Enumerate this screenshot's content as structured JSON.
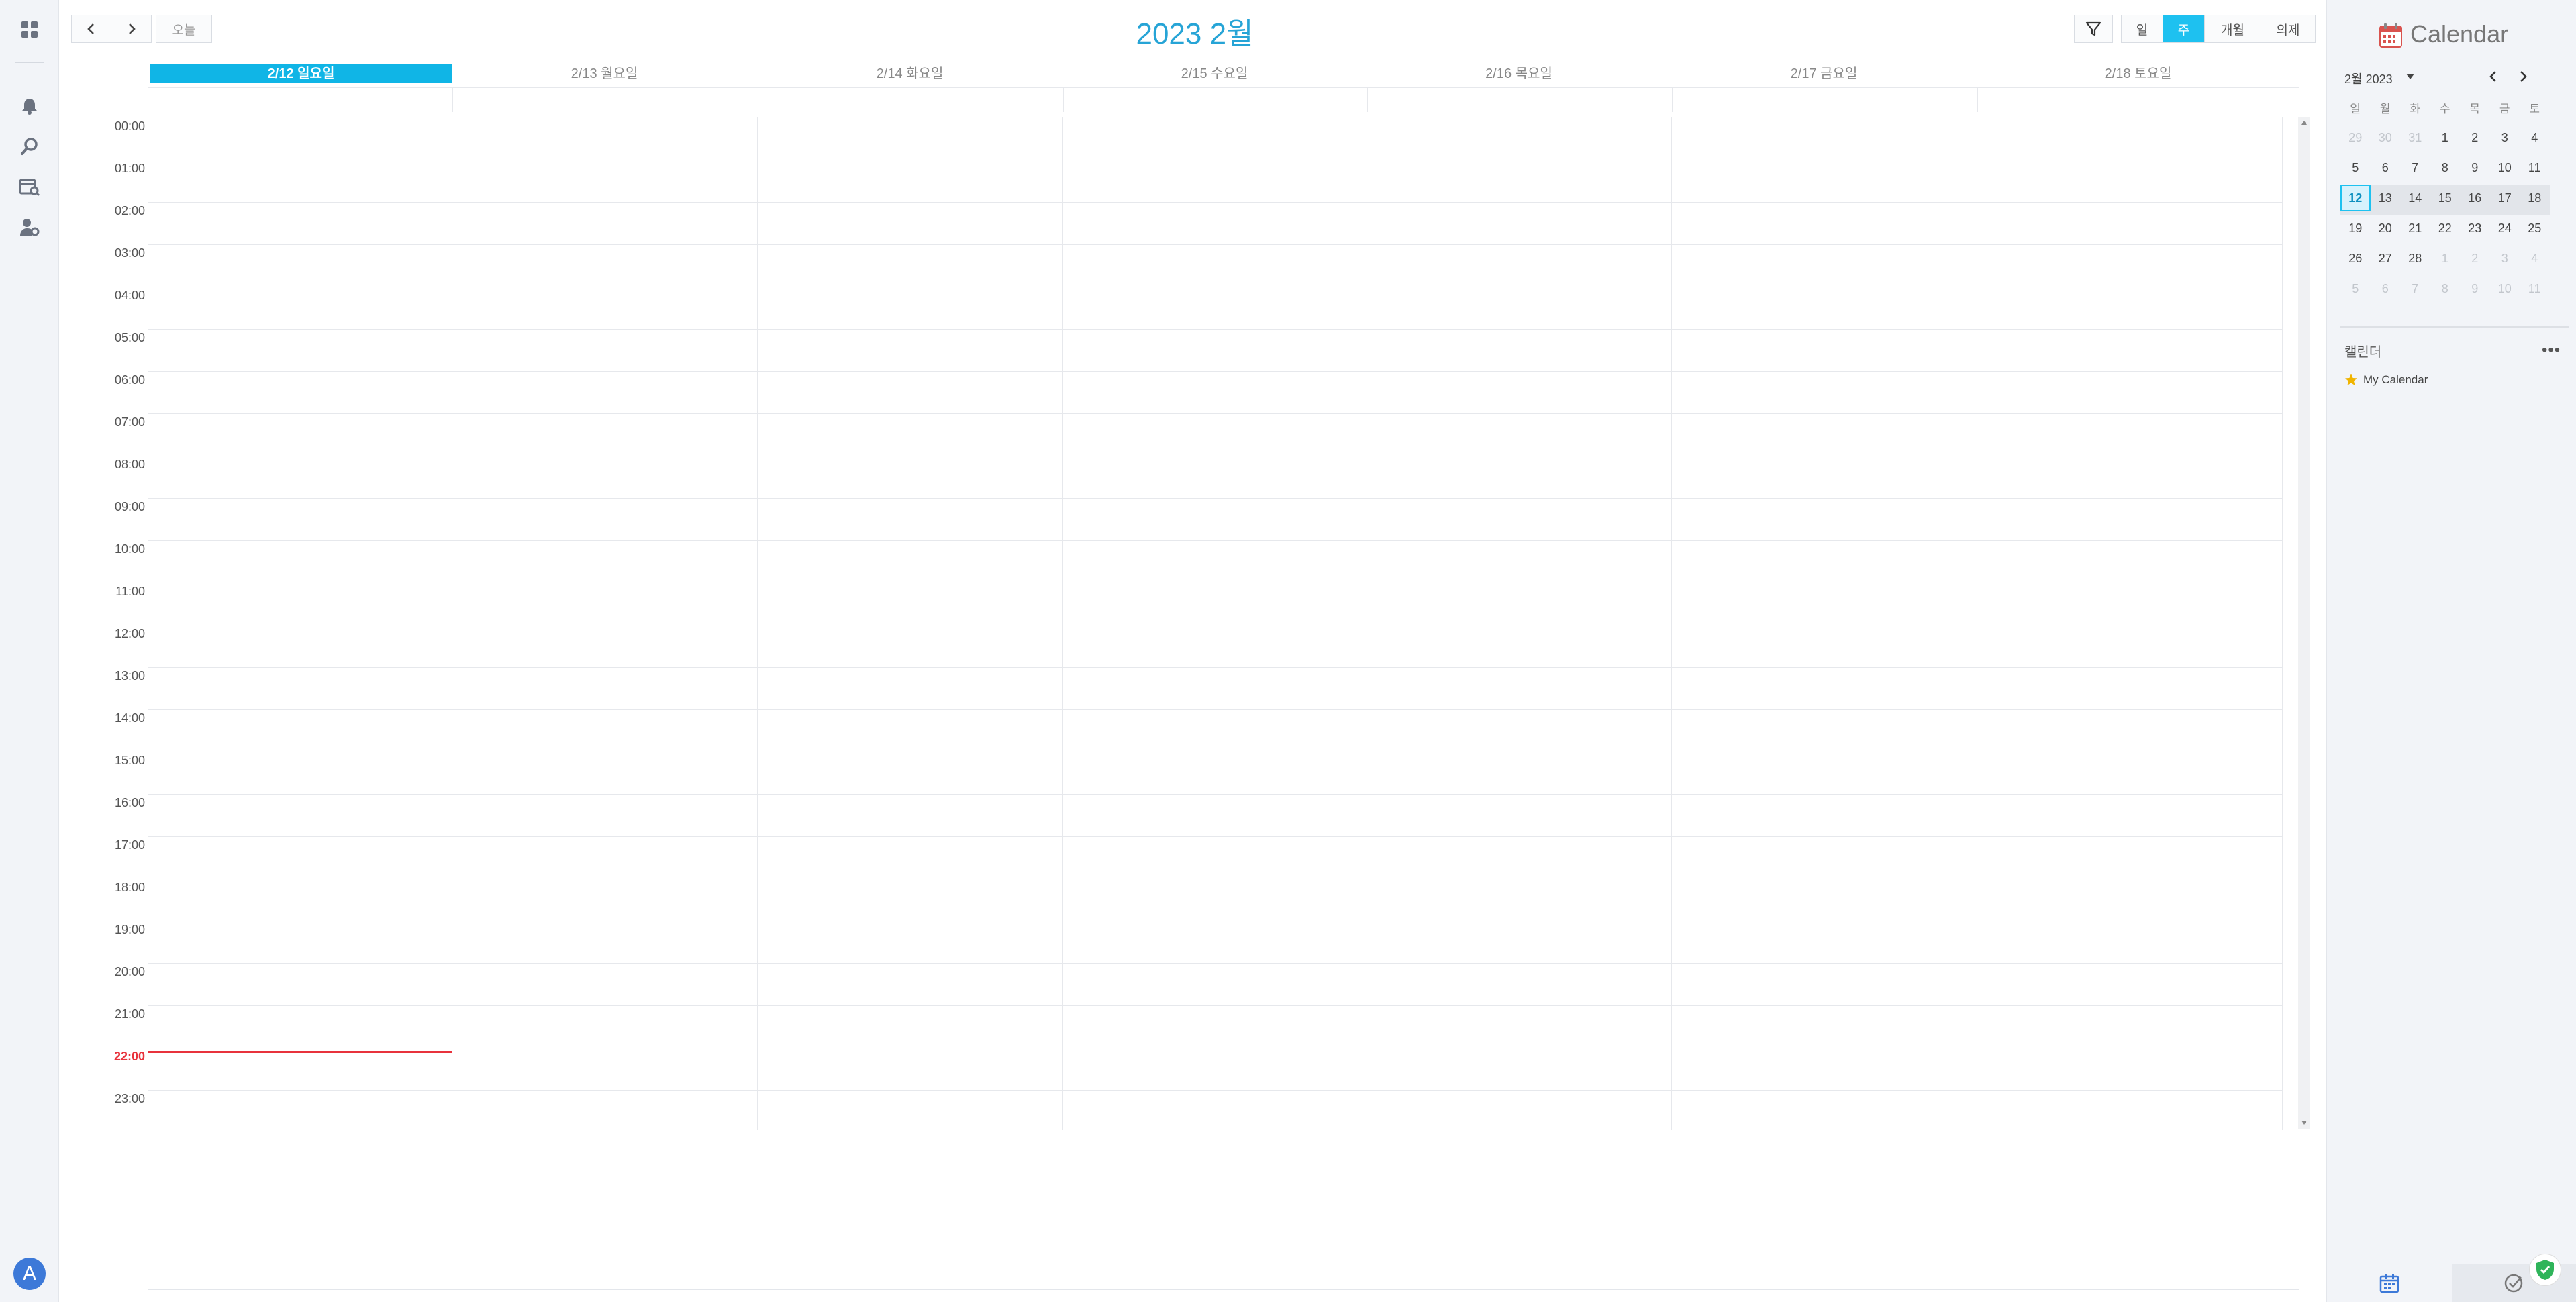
{
  "toolbar": {
    "today_label": "오늘",
    "title": "2023 2월",
    "views": [
      {
        "label": "일",
        "active": false
      },
      {
        "label": "주",
        "active": true
      },
      {
        "label": "개월",
        "active": false
      },
      {
        "label": "의제",
        "active": false
      }
    ],
    "accent_color": "#1ec1f0"
  },
  "week": {
    "days": [
      {
        "label": "2/12 일요일",
        "today": true
      },
      {
        "label": "2/13 월요일",
        "today": false
      },
      {
        "label": "2/14 화요일",
        "today": false
      },
      {
        "label": "2/15 수요일",
        "today": false
      },
      {
        "label": "2/16 목요일",
        "today": false
      },
      {
        "label": "2/17 금요일",
        "today": false
      },
      {
        "label": "2/18 토요일",
        "today": false
      }
    ],
    "hours": [
      "00:00",
      "01:00",
      "02:00",
      "03:00",
      "04:00",
      "05:00",
      "06:00",
      "07:00",
      "08:00",
      "09:00",
      "10:00",
      "11:00",
      "12:00",
      "13:00",
      "14:00",
      "15:00",
      "16:00",
      "17:00",
      "18:00",
      "19:00",
      "20:00",
      "21:00",
      "22:00",
      "23:00"
    ],
    "now_hour": "22:00",
    "now_color": "#e8323c"
  },
  "sidebar_left": {
    "icons": [
      "dashboard-icon",
      "bell-icon",
      "search-icon",
      "calendar-search-icon",
      "user-settings-icon"
    ],
    "avatar_letter": "A"
  },
  "panel": {
    "app_title": "Calendar",
    "mini": {
      "month_label": "2월 2023",
      "weekdays": [
        "일",
        "월",
        "화",
        "수",
        "목",
        "금",
        "토"
      ],
      "weeks": [
        [
          {
            "d": "29",
            "o": true
          },
          {
            "d": "30",
            "o": true
          },
          {
            "d": "31",
            "o": true
          },
          {
            "d": "1"
          },
          {
            "d": "2"
          },
          {
            "d": "3"
          },
          {
            "d": "4"
          }
        ],
        [
          {
            "d": "5"
          },
          {
            "d": "6"
          },
          {
            "d": "7"
          },
          {
            "d": "8"
          },
          {
            "d": "9"
          },
          {
            "d": "10"
          },
          {
            "d": "11"
          }
        ],
        [
          {
            "d": "12",
            "sel": true
          },
          {
            "d": "13"
          },
          {
            "d": "14"
          },
          {
            "d": "15"
          },
          {
            "d": "16"
          },
          {
            "d": "17"
          },
          {
            "d": "18"
          }
        ],
        [
          {
            "d": "19"
          },
          {
            "d": "20"
          },
          {
            "d": "21"
          },
          {
            "d": "22"
          },
          {
            "d": "23"
          },
          {
            "d": "24"
          },
          {
            "d": "25"
          }
        ],
        [
          {
            "d": "26"
          },
          {
            "d": "27"
          },
          {
            "d": "28"
          },
          {
            "d": "1",
            "o": true
          },
          {
            "d": "2",
            "o": true
          },
          {
            "d": "3",
            "o": true
          },
          {
            "d": "4",
            "o": true
          }
        ],
        [
          {
            "d": "5",
            "o": true
          },
          {
            "d": "6",
            "o": true
          },
          {
            "d": "7",
            "o": true
          },
          {
            "d": "8",
            "o": true
          },
          {
            "d": "9",
            "o": true
          },
          {
            "d": "10",
            "o": true
          },
          {
            "d": "11",
            "o": true
          }
        ]
      ],
      "current_week": 2
    },
    "calendars_label": "캘린더",
    "calendars": [
      {
        "name": "My Calendar",
        "color": "#f0b400"
      }
    ]
  }
}
